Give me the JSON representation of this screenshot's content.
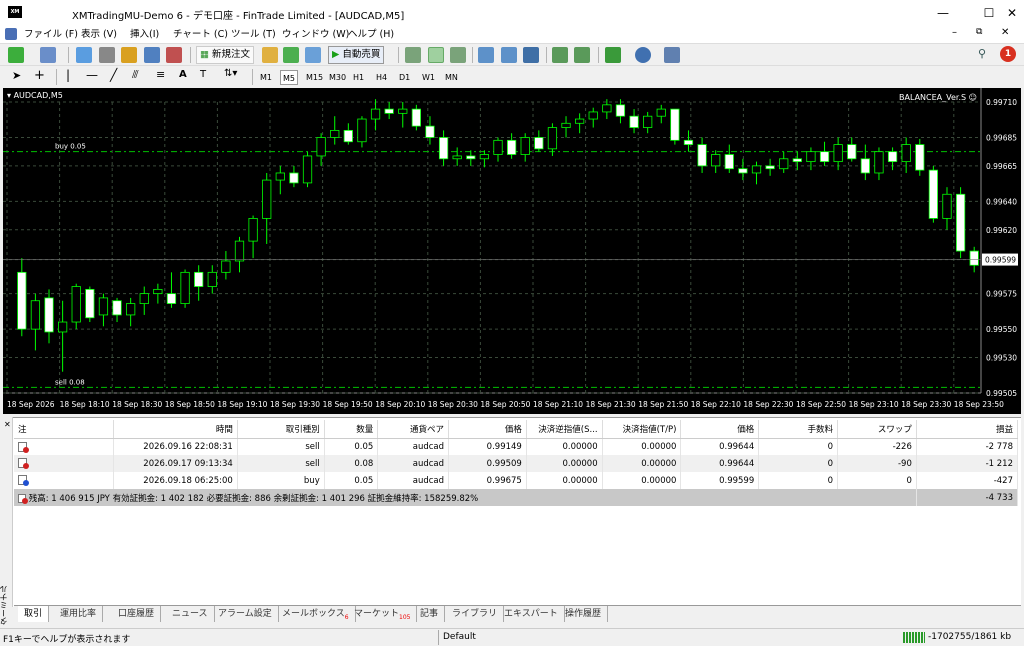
{
  "window": {
    "title": "XMTradingMU-Demo 6 - デモ口座 - FinTrade Limited - [AUDCAD,M5]",
    "icon_text": "XM"
  },
  "menu": [
    "ファイル (F)",
    "表示 (V)",
    "挿入(I)",
    "チャート (C)",
    "ツール (T)",
    "ウィンドウ (W)",
    "ヘルプ (H)"
  ],
  "notification_count": "1",
  "toolbar": {
    "new_order": "新規注文",
    "auto_trading": "自動売買"
  },
  "timeframes": [
    "M1",
    "M5",
    "M15",
    "M30",
    "H1",
    "H4",
    "D1",
    "W1",
    "MN"
  ],
  "selected_timeframe": "M5",
  "chart": {
    "symbol_label": "AUDCAD,M5",
    "ea_label": "BALANCEA_Ver.S",
    "current_price": "0.99599",
    "buy_line_label": "buy 0.05",
    "sell_line_label": "sell 0.08",
    "colors": {
      "background": "#000000",
      "bull": "#ffffff",
      "bear": "#ffffff",
      "wick": "#00ff00",
      "grid": "#3a4a3a",
      "level": "#00c000"
    }
  },
  "chart_data": {
    "type": "candlestick",
    "symbol": "AUDCAD",
    "timeframe": "M5",
    "ylim": [
      0.99505,
      0.9971
    ],
    "y_ticks": [
      "0.99710",
      "0.99685",
      "0.99665",
      "0.99640",
      "0.99620",
      "0.99599",
      "0.99575",
      "0.99550",
      "0.99530",
      "0.99505"
    ],
    "x_ticks": [
      "18 Sep 2026",
      "18 Sep 18:10",
      "18 Sep 18:30",
      "18 Sep 18:50",
      "18 Sep 19:10",
      "18 Sep 19:30",
      "18 Sep 19:50",
      "18 Sep 20:10",
      "18 Sep 20:30",
      "18 Sep 20:50",
      "18 Sep 21:10",
      "18 Sep 21:30",
      "18 Sep 21:50",
      "18 Sep 22:10",
      "18 Sep 22:30",
      "18 Sep 22:50",
      "18 Sep 23:10",
      "18 Sep 23:30",
      "18 Sep 23:50"
    ],
    "levels": [
      {
        "name": "buy 0.05",
        "price": 0.99675
      },
      {
        "name": "sell 0.08",
        "price": 0.99509
      }
    ],
    "candles": [
      [
        0.9959,
        0.996,
        0.99545,
        0.9955
      ],
      [
        0.9955,
        0.99575,
        0.99535,
        0.9957
      ],
      [
        0.99572,
        0.99578,
        0.9954,
        0.99548
      ],
      [
        0.99548,
        0.9957,
        0.9952,
        0.99555
      ],
      [
        0.99555,
        0.99582,
        0.9955,
        0.9958
      ],
      [
        0.99578,
        0.9958,
        0.99555,
        0.99558
      ],
      [
        0.9956,
        0.99575,
        0.99552,
        0.99572
      ],
      [
        0.9957,
        0.99572,
        0.99555,
        0.9956
      ],
      [
        0.9956,
        0.99572,
        0.99552,
        0.99568
      ],
      [
        0.99568,
        0.9958,
        0.9956,
        0.99575
      ],
      [
        0.99575,
        0.99582,
        0.99568,
        0.99578
      ],
      [
        0.99575,
        0.9959,
        0.99565,
        0.99568
      ],
      [
        0.99568,
        0.99592,
        0.99565,
        0.9959
      ],
      [
        0.9959,
        0.99595,
        0.9957,
        0.9958
      ],
      [
        0.9958,
        0.99595,
        0.99575,
        0.9959
      ],
      [
        0.9959,
        0.99605,
        0.99585,
        0.99598
      ],
      [
        0.99598,
        0.99615,
        0.9959,
        0.99612
      ],
      [
        0.99612,
        0.9963,
        0.996,
        0.99628
      ],
      [
        0.99628,
        0.9966,
        0.9961,
        0.99655
      ],
      [
        0.99655,
        0.99665,
        0.99645,
        0.9966
      ],
      [
        0.9966,
        0.99665,
        0.9965,
        0.99653
      ],
      [
        0.99653,
        0.99675,
        0.9965,
        0.99672
      ],
      [
        0.99672,
        0.99688,
        0.99665,
        0.99685
      ],
      [
        0.99685,
        0.997,
        0.9968,
        0.9969
      ],
      [
        0.9969,
        0.99695,
        0.9968,
        0.99682
      ],
      [
        0.99682,
        0.997,
        0.99678,
        0.99698
      ],
      [
        0.99698,
        0.99712,
        0.9969,
        0.99705
      ],
      [
        0.99705,
        0.9971,
        0.99698,
        0.99702
      ],
      [
        0.99702,
        0.9971,
        0.99692,
        0.99705
      ],
      [
        0.99705,
        0.99708,
        0.9969,
        0.99693
      ],
      [
        0.99693,
        0.997,
        0.9968,
        0.99685
      ],
      [
        0.99685,
        0.9969,
        0.99665,
        0.9967
      ],
      [
        0.9967,
        0.99678,
        0.99665,
        0.99672
      ],
      [
        0.99672,
        0.99676,
        0.99665,
        0.9967
      ],
      [
        0.9967,
        0.99676,
        0.99664,
        0.99673
      ],
      [
        0.99673,
        0.99685,
        0.99668,
        0.99683
      ],
      [
        0.99683,
        0.99688,
        0.9967,
        0.99673
      ],
      [
        0.99673,
        0.99688,
        0.99668,
        0.99685
      ],
      [
        0.99685,
        0.9969,
        0.99675,
        0.99677
      ],
      [
        0.99677,
        0.99695,
        0.99672,
        0.99692
      ],
      [
        0.99692,
        0.997,
        0.99685,
        0.99695
      ],
      [
        0.99695,
        0.99702,
        0.99688,
        0.99698
      ],
      [
        0.99698,
        0.99706,
        0.99692,
        0.99703
      ],
      [
        0.99703,
        0.99712,
        0.99698,
        0.99708
      ],
      [
        0.99708,
        0.99712,
        0.99695,
        0.997
      ],
      [
        0.997,
        0.99705,
        0.99688,
        0.99692
      ],
      [
        0.99692,
        0.99703,
        0.99688,
        0.997
      ],
      [
        0.997,
        0.99708,
        0.99695,
        0.99705
      ],
      [
        0.99705,
        0.99705,
        0.9968,
        0.99683
      ],
      [
        0.99683,
        0.9969,
        0.99675,
        0.9968
      ],
      [
        0.9968,
        0.99685,
        0.9966,
        0.99665
      ],
      [
        0.99665,
        0.99676,
        0.9966,
        0.99673
      ],
      [
        0.99673,
        0.9968,
        0.9966,
        0.99663
      ],
      [
        0.99663,
        0.9967,
        0.99655,
        0.9966
      ],
      [
        0.9966,
        0.99668,
        0.99652,
        0.99665
      ],
      [
        0.99665,
        0.9967,
        0.99658,
        0.99663
      ],
      [
        0.99663,
        0.99675,
        0.9966,
        0.9967
      ],
      [
        0.9967,
        0.99675,
        0.99662,
        0.99668
      ],
      [
        0.99668,
        0.99678,
        0.99662,
        0.99675
      ],
      [
        0.99675,
        0.99682,
        0.99665,
        0.99668
      ],
      [
        0.99668,
        0.99685,
        0.99662,
        0.9968
      ],
      [
        0.9968,
        0.99685,
        0.99668,
        0.9967
      ],
      [
        0.9967,
        0.9968,
        0.99655,
        0.9966
      ],
      [
        0.9966,
        0.99678,
        0.99655,
        0.99675
      ],
      [
        0.99675,
        0.99678,
        0.99662,
        0.99668
      ],
      [
        0.99668,
        0.99685,
        0.9966,
        0.9968
      ],
      [
        0.9968,
        0.99684,
        0.99658,
        0.99662
      ],
      [
        0.99662,
        0.99665,
        0.99625,
        0.99628
      ],
      [
        0.99628,
        0.9965,
        0.9962,
        0.99645
      ],
      [
        0.99645,
        0.9965,
        0.996,
        0.99605
      ],
      [
        0.99605,
        0.99608,
        0.9959,
        0.99595
      ]
    ]
  },
  "terminal": {
    "headers": [
      "注",
      "時間",
      "取引種別",
      "数量",
      "通貨ペア",
      "価格",
      "決済逆指値(S...",
      "決済指値(T/P)",
      "価格",
      "手数料",
      "スワップ",
      "損益"
    ],
    "rows": [
      {
        "time": "2026.09.16 22:08:31",
        "type": "sell",
        "volume": "0.05",
        "symbol": "audcad",
        "price": "0.99149",
        "sl": "0.00000",
        "tp": "0.00000",
        "cur_price": "0.99644",
        "commission": "0",
        "swap": "-226",
        "profit": "-2 778",
        "icon_color": "#d02020"
      },
      {
        "time": "2026.09.17 09:13:34",
        "type": "sell",
        "volume": "0.08",
        "symbol": "audcad",
        "price": "0.99509",
        "sl": "0.00000",
        "tp": "0.00000",
        "cur_price": "0.99644",
        "commission": "0",
        "swap": "-90",
        "profit": "-1 212",
        "icon_color": "#d02020"
      },
      {
        "time": "2026.09.18 06:25:00",
        "type": "buy",
        "volume": "0.05",
        "symbol": "audcad",
        "price": "0.99675",
        "sl": "0.00000",
        "tp": "0.00000",
        "cur_price": "0.99599",
        "commission": "0",
        "swap": "0",
        "profit": "-427",
        "icon_color": "#2050d0"
      }
    ],
    "summary": "残高: 1 406 915 JPY  有効証拠金: 1 402 182  必要証拠金: 886  余剰証拠金: 1 401 296  証拠金維持率: 158259.82%",
    "summary_profit": "-4 733",
    "side_label": "ターミナル"
  },
  "tabs": [
    {
      "label": "取引",
      "badge": ""
    },
    {
      "label": "運用比率",
      "badge": ""
    },
    {
      "label": "口座履歴",
      "badge": ""
    },
    {
      "label": "ニュース",
      "badge": ""
    },
    {
      "label": "アラーム設定",
      "badge": ""
    },
    {
      "label": "メールボックス",
      "badge": "6"
    },
    {
      "label": "マーケット",
      "badge": "105"
    },
    {
      "label": "記事",
      "badge": ""
    },
    {
      "label": "ライブラリ",
      "badge": ""
    },
    {
      "label": "エキスパート",
      "badge": ""
    },
    {
      "label": "操作履歴",
      "badge": ""
    }
  ],
  "status": {
    "help": "F1キーでヘルプが表示されます",
    "profile": "Default",
    "traffic": "-1702755/1861 kb"
  }
}
